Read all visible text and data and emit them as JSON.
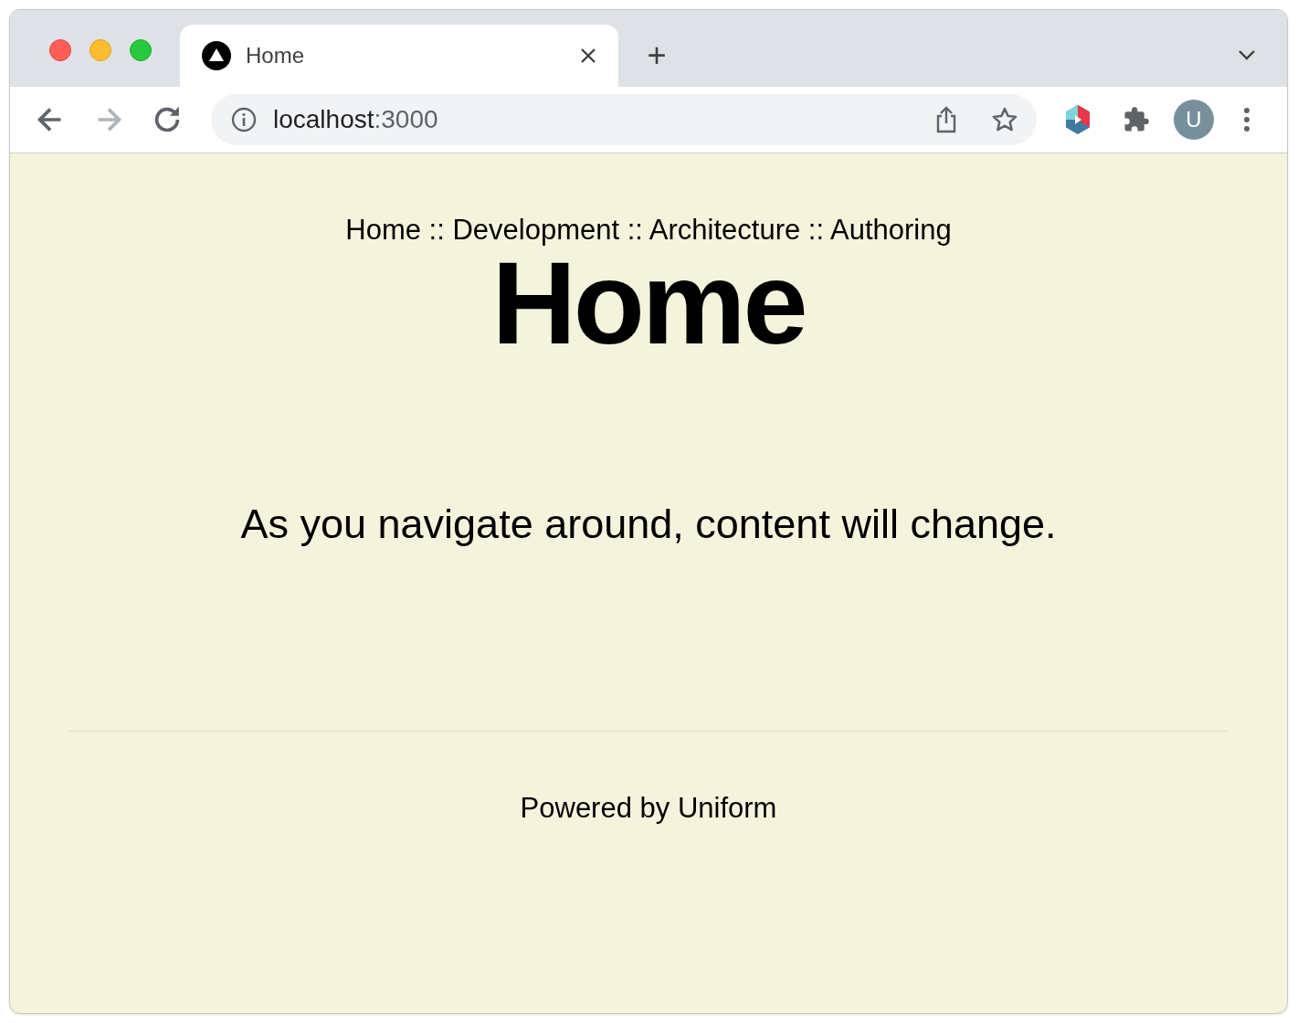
{
  "tabs": [
    {
      "title": "Home",
      "selected": true
    }
  ],
  "new_tab": "+",
  "nav": [
    {
      "kind": "back",
      "disabled": false
    },
    {
      "kind": "forward",
      "disabled": true
    },
    {
      "kind": "reload",
      "disabled": false
    }
  ],
  "address": {
    "host": "localhost",
    "port": ":3000"
  },
  "avatar": "U",
  "page": {
    "breadcrumb": "Home :: Development :: Architecture :: Authoring",
    "heading": "Home",
    "message": "As you navigate around, content will change.",
    "footer": "Powered by Uniform"
  }
}
